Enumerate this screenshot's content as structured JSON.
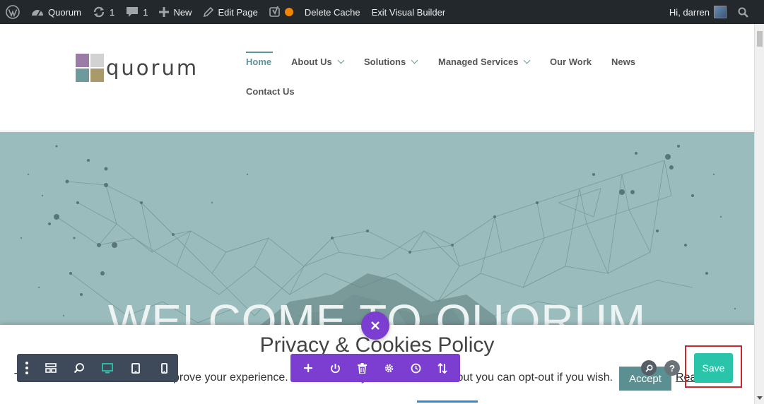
{
  "admin_bar": {
    "wp_logo_icon": "wordpress-icon",
    "site_name": "Quorum",
    "updates_count": "1",
    "comments_count": "1",
    "new_label": "New",
    "edit_page_label": "Edit Page",
    "delete_cache_label": "Delete Cache",
    "exit_builder_label": "Exit Visual Builder",
    "greeting": "Hi, darren"
  },
  "site": {
    "logo_text": "quorum",
    "logo_colors": [
      "#9a7ca6",
      "#c9c9c9",
      "#6d9b9d",
      "#a89a6a"
    ],
    "nav": {
      "home": "Home",
      "about": "About Us",
      "solutions": "Solutions",
      "managed": "Managed Services",
      "work": "Our Work",
      "news": "News",
      "contact": "Contact Us"
    },
    "accent": "#5c9497"
  },
  "hero": {
    "title": "WELCOME TO QUORUM",
    "background": "#9bbcbd"
  },
  "cookie": {
    "title": "Privacy & Cookies Policy",
    "text": "This website uses cookies to improve your experience. We'll assume you're ok with this, but you can opt-out if you wish.",
    "accept_label": "Accept",
    "read_more_label": "Read More"
  },
  "builder": {
    "save_label": "Save",
    "help_label": "?",
    "left_toolbar_icons": [
      "more-icon",
      "layout-icon",
      "zoom-icon",
      "desktop-icon",
      "tablet-icon",
      "phone-icon"
    ],
    "mid_toolbar_icons": [
      "add-icon",
      "power-icon",
      "trash-icon",
      "settings-icon",
      "history-icon",
      "sort-icon"
    ],
    "colors": {
      "purple": "#7b3ed1",
      "dark": "#3e4a59",
      "save": "#29c4a9",
      "highlight": "#c8282e"
    }
  }
}
